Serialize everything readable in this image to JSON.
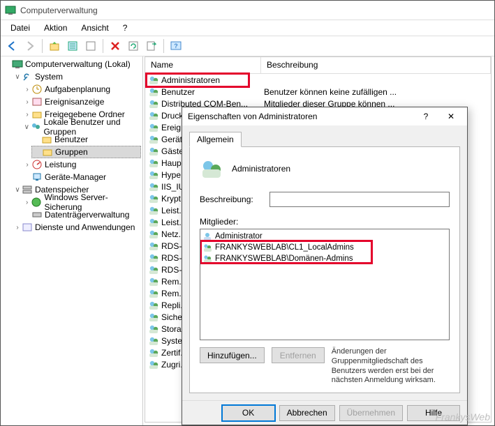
{
  "window": {
    "title": "Computerverwaltung"
  },
  "menu": {
    "file": "Datei",
    "action": "Aktion",
    "view": "Ansicht",
    "help": "?"
  },
  "tree": {
    "root": "Computerverwaltung (Lokal)",
    "system": "System",
    "task_sched": "Aufgabenplanung",
    "event_viewer": "Ereignisanzeige",
    "shared_folders": "Freigegebene Ordner",
    "local_users": "Lokale Benutzer und Gruppen",
    "users": "Benutzer",
    "groups": "Gruppen",
    "performance": "Leistung",
    "device_mgr": "Geräte-Manager",
    "storage": "Datenspeicher",
    "wsb": "Windows Server-Sicherung",
    "disk_mgmt": "Datenträgerverwaltung",
    "services_apps": "Dienste und Anwendungen"
  },
  "list": {
    "col_name": "Name",
    "col_desc": "Beschreibung",
    "rows": [
      {
        "name": "Administratoren",
        "desc": ""
      },
      {
        "name": "Benutzer",
        "desc": "Benutzer können keine zufälligen ..."
      },
      {
        "name": "Distributed COM-Ben...",
        "desc": "Mitglieder dieser Gruppe können ..."
      },
      {
        "name": "Druck...",
        "desc": ""
      },
      {
        "name": "Ereig...",
        "desc": ""
      },
      {
        "name": "Gerät...",
        "desc": ""
      },
      {
        "name": "Gäste",
        "desc": ""
      },
      {
        "name": "Haup...",
        "desc": ""
      },
      {
        "name": "Hype...",
        "desc": ""
      },
      {
        "name": "IIS_IU...",
        "desc": ""
      },
      {
        "name": "Krypt...",
        "desc": ""
      },
      {
        "name": "Leist...",
        "desc": ""
      },
      {
        "name": "Leist...",
        "desc": ""
      },
      {
        "name": "Netz...",
        "desc": ""
      },
      {
        "name": "RDS-...",
        "desc": ""
      },
      {
        "name": "RDS-...",
        "desc": ""
      },
      {
        "name": "RDS-...",
        "desc": ""
      },
      {
        "name": "Rem...",
        "desc": ""
      },
      {
        "name": "Rem...",
        "desc": ""
      },
      {
        "name": "Repli...",
        "desc": ""
      },
      {
        "name": "Siche...",
        "desc": ""
      },
      {
        "name": "Stora...",
        "desc": ""
      },
      {
        "name": "Syste...",
        "desc": ""
      },
      {
        "name": "Zertif...",
        "desc": ""
      },
      {
        "name": "Zugri...",
        "desc": ""
      }
    ]
  },
  "dialog": {
    "title": "Eigenschaften von Administratoren",
    "tab_general": "Allgemein",
    "group_name": "Administratoren",
    "desc_label": "Beschreibung:",
    "desc_value": "",
    "members_label": "Mitglieder:",
    "members": [
      {
        "name": "Administrator",
        "type": "user"
      },
      {
        "name": "FRANKYSWEBLAB\\CL1_LocalAdmins",
        "type": "group"
      },
      {
        "name": "FRANKYSWEBLAB\\Domänen-Admins",
        "type": "group"
      }
    ],
    "add": "Hinzufügen...",
    "remove": "Entfernen",
    "note": "Änderungen der Gruppenmitgliedschaft des Benutzers werden erst bei der nächsten Anmeldung wirksam.",
    "ok": "OK",
    "cancel": "Abbrechen",
    "apply": "Übernehmen",
    "help": "Hilfe"
  },
  "watermark": "FrankysWeb"
}
